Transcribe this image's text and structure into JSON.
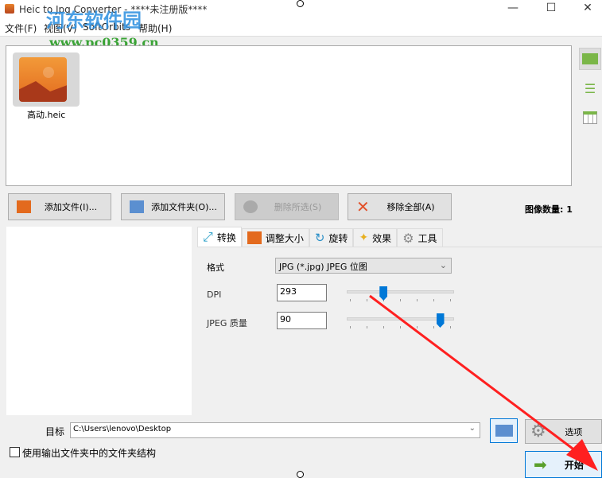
{
  "window": {
    "title": "Heic to Jpg Converter - ****未注册版****",
    "minimize": "—",
    "maximize": "☐",
    "close": "✕"
  },
  "menu": [
    "文件(F)",
    "视图(V)",
    "SoftOrbits",
    "帮助(H)"
  ],
  "watermark": {
    "name": "河东软件园",
    "url": "www.pc0359.cn"
  },
  "files": [
    {
      "name": "高动.heic"
    }
  ],
  "toolbar": {
    "add_file": "添加文件(I)...",
    "add_folder": "添加文件夹(O)...",
    "remove_selected": "删除所选(S)",
    "remove_all": "移除全部(A)",
    "image_count": "图像数量: 1"
  },
  "tabs": [
    "转换",
    "调整大小",
    "旋转",
    "效果",
    "工具"
  ],
  "convert": {
    "format_label": "格式",
    "format_value": "JPG (*.jpg) JPEG 位图",
    "dpi_label": "DPI",
    "dpi_value": "293",
    "dpi_slider": 0.33,
    "quality_label": "JPEG 质量",
    "quality_value": "90",
    "quality_slider": 0.9
  },
  "output": {
    "target_label": "目标",
    "target_path": "C:\\Users\\lenovo\\Desktop",
    "options": "选项",
    "keep_structure": "使用输出文件夹中的文件夹结构",
    "keep_structure_checked": false,
    "start": "开始"
  },
  "colors": {
    "accent": "#0078d7",
    "arrow": "#ff2020",
    "green": "#7ab648"
  }
}
